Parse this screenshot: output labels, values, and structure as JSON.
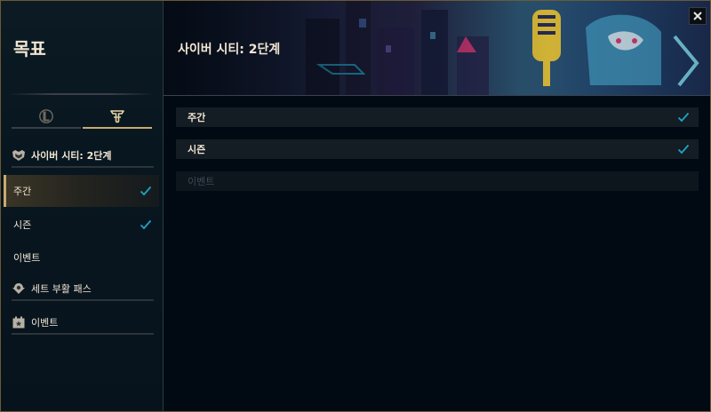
{
  "sidebar": {
    "title": "목표",
    "tabs": [
      {
        "icon": "lol-logo-icon",
        "selected": false
      },
      {
        "icon": "tft-logo-icon",
        "selected": true
      }
    ],
    "section_header": "사이버 시티: 2단계",
    "section_items": [
      {
        "label": "주간",
        "active": true,
        "completed": true
      },
      {
        "label": "시즌",
        "active": false,
        "completed": true
      },
      {
        "label": "이벤트",
        "active": false,
        "completed": false
      }
    ],
    "groups": [
      {
        "label": "세트 부활 패스",
        "icon": "revival-pass-icon"
      },
      {
        "label": "이벤트",
        "icon": "event-calendar-icon"
      }
    ]
  },
  "main": {
    "title": "사이버 시티: 2단계",
    "rows": [
      {
        "label": "주간",
        "completed": true,
        "disabled": false
      },
      {
        "label": "시즌",
        "completed": true,
        "disabled": false
      },
      {
        "label": "이벤트",
        "completed": false,
        "disabled": true
      }
    ]
  },
  "colors": {
    "gold_accent": "#c8aa6e",
    "check_blue": "#1fa3c4",
    "text_primary": "#f0e6d2",
    "text_disabled": "#3e4a52"
  }
}
